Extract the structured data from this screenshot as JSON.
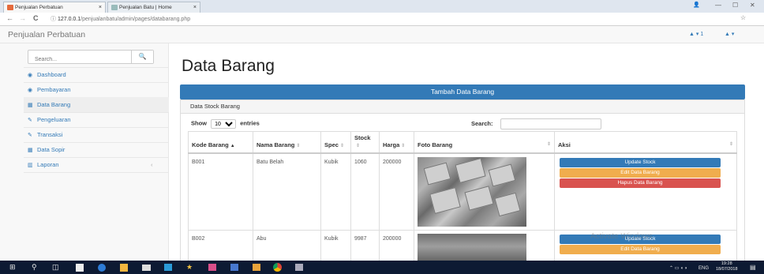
{
  "browser": {
    "tabs": [
      {
        "title": "Penjualan Perbatuan",
        "close": "×"
      },
      {
        "title": "Penjualan Batu | Home",
        "close": "×"
      }
    ],
    "url_host": "127.0.0.1",
    "url_path": "/penjualanbatu/admin/pages/databarang.php",
    "url_icon": "ⓘ",
    "star": "☆",
    "back": "←",
    "forward": "→",
    "reload": "C",
    "window_controls": {
      "profile": "👤",
      "minimize": "—",
      "maximize": "☐",
      "close": "✕"
    }
  },
  "app": {
    "brand": "Penjualan Perbatuan",
    "header_icons": [
      {
        "icon": "bell-icon",
        "glyph": "▲ ▾ 1"
      },
      {
        "icon": "user-icon",
        "glyph": "▲ ▾"
      }
    ]
  },
  "sidebar": {
    "search_placeholder": "Search...",
    "search_icon": "🔍",
    "items": [
      {
        "label": "Dashboard",
        "icon": "dashboard-icon",
        "glyph": "◉"
      },
      {
        "label": "Pembayaran",
        "icon": "payment-icon",
        "glyph": "◉"
      },
      {
        "label": "Data Barang",
        "icon": "table-icon",
        "glyph": "▦"
      },
      {
        "label": "Pengeluaran",
        "icon": "edit-icon",
        "glyph": "✎"
      },
      {
        "label": "Transaksi",
        "icon": "edit-icon",
        "glyph": "✎"
      },
      {
        "label": "Data Sopir",
        "icon": "table-icon",
        "glyph": "▦"
      },
      {
        "label": "Laporan",
        "icon": "bar-chart-icon",
        "glyph": "▥",
        "chevron": "‹"
      }
    ]
  },
  "main": {
    "title": "Data Barang",
    "add_button": "Tambah Data Barang",
    "panel_heading": "Data Stock Barang",
    "show_label": "Show",
    "entries_value": "10",
    "entries_label": "entries",
    "search_label": "Search:",
    "columns": [
      "Kode Barang",
      "Nama Barang",
      "Spec",
      "Stock",
      "Harga",
      "Foto Barang",
      "Aksi"
    ],
    "sort_glyphs": {
      "asc": "▲",
      "both": "⇕"
    },
    "rows": [
      {
        "kode": "B001",
        "nama": "Batu Belah",
        "spec": "Kubik",
        "stock": "1060",
        "harga": "200000"
      },
      {
        "kode": "B002",
        "nama": "Abu",
        "spec": "Kubik",
        "stock": "9987",
        "harga": "200000"
      }
    ],
    "actions": {
      "update": "Update Stock",
      "edit": "Edit Data Barang",
      "delete": "Hapus Data Barang"
    },
    "watermark": "Activate Windows"
  },
  "taskbar": {
    "start": "⊞",
    "search": "⚲",
    "taskview": "◫",
    "tray_text": "ENG",
    "time": "19:28",
    "date": "18/07/2018"
  }
}
